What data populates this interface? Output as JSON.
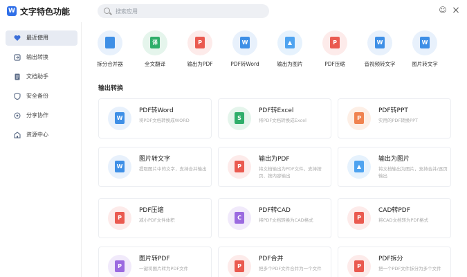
{
  "app": {
    "logo": "W",
    "title": "文字特色功能"
  },
  "search": {
    "placeholder": "搜索应用"
  },
  "window": {
    "chat_icon": "☺",
    "close_icon": "×"
  },
  "sidebar": {
    "items": [
      {
        "label": "最近使用",
        "icon": "heart-icon"
      },
      {
        "label": "输出转换",
        "icon": "convert-icon"
      },
      {
        "label": "文档助手",
        "icon": "document-icon"
      },
      {
        "label": "安全备份",
        "icon": "shield-icon"
      },
      {
        "label": "分享协作",
        "icon": "share-icon"
      },
      {
        "label": "资源中心",
        "icon": "resource-icon"
      }
    ]
  },
  "quick_tools": [
    {
      "label": "拆分合并器",
      "glyph": "",
      "color": "blue"
    },
    {
      "label": "全文翻译",
      "glyph": "译",
      "color": "green"
    },
    {
      "label": "输出为PDF",
      "glyph": "P",
      "color": "red"
    },
    {
      "label": "PDF转Word",
      "glyph": "W",
      "color": "blue"
    },
    {
      "label": "输出为图片",
      "glyph": "▲",
      "color": "skyblue"
    },
    {
      "label": "PDF压缩",
      "glyph": "P",
      "color": "red"
    },
    {
      "label": "音视频转文字",
      "glyph": "W",
      "color": "blue"
    },
    {
      "label": "图片转文字",
      "glyph": "W",
      "color": "blue"
    }
  ],
  "section": {
    "title": "输出转换"
  },
  "cards": [
    {
      "title": "PDF转Word",
      "desc": "将PDF文档转换成WORD",
      "glyph": "W",
      "color": "blue"
    },
    {
      "title": "PDF转Excel",
      "desc": "将PDF文档转换成Excel",
      "glyph": "S",
      "color": "green"
    },
    {
      "title": "PDF转PPT",
      "desc": "实用的PDF转换PPT",
      "glyph": "P",
      "color": "orange"
    },
    {
      "title": "图片转文字",
      "desc": "提取图片中的文字，支持合并输出",
      "glyph": "W",
      "color": "blue"
    },
    {
      "title": "输出为PDF",
      "desc": "将文档输出为PDF文件，支持按页、按内容输出",
      "glyph": "P",
      "color": "red"
    },
    {
      "title": "输出为图片",
      "desc": "将文档输出为图片，支持合并/逐页输出",
      "glyph": "▲",
      "color": "skyblue"
    },
    {
      "title": "PDF压缩",
      "desc": "减小PDF文件体积",
      "glyph": "P",
      "color": "red"
    },
    {
      "title": "PDF转CAD",
      "desc": "将PDF文档转换为CAD格式",
      "glyph": "C",
      "color": "purple"
    },
    {
      "title": "CAD转PDF",
      "desc": "将CAD文档转为PDF格式",
      "glyph": "P",
      "color": "red"
    },
    {
      "title": "图片转PDF",
      "desc": "一键将图片转为PDF文件",
      "glyph": "P",
      "color": "purple"
    },
    {
      "title": "PDF合并",
      "desc": "把多个PDF文件合并为一个文件",
      "glyph": "P",
      "color": "red"
    },
    {
      "title": "PDF拆分",
      "desc": "把一个PDF文件拆分为多个文件",
      "glyph": "P",
      "color": "red"
    }
  ]
}
